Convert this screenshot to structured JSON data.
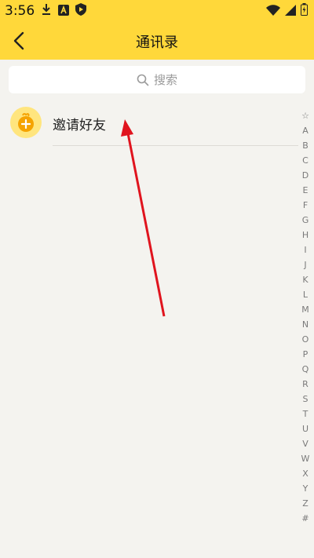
{
  "status_bar": {
    "time": "3:56",
    "left_icons": [
      "download-icon",
      "a-app-icon",
      "play-shield-icon"
    ],
    "right_icons": [
      "wifi-icon",
      "signal-icon",
      "battery-icon"
    ]
  },
  "header": {
    "title": "通讯录",
    "back_icon": "chevron-left-icon",
    "background": "#ffd83a"
  },
  "search": {
    "placeholder": "搜索"
  },
  "invite": {
    "label": "邀请好友",
    "icon": "add-friend-icon",
    "accent": "#f5a300"
  },
  "index_bar": {
    "letters": [
      "☆",
      "A",
      "B",
      "C",
      "D",
      "E",
      "F",
      "G",
      "H",
      "I",
      "J",
      "K",
      "L",
      "M",
      "N",
      "O",
      "P",
      "Q",
      "R",
      "S",
      "T",
      "U",
      "V",
      "W",
      "X",
      "Y",
      "Z",
      "#"
    ]
  },
  "annotation": {
    "arrow_color": "#e0141e"
  }
}
